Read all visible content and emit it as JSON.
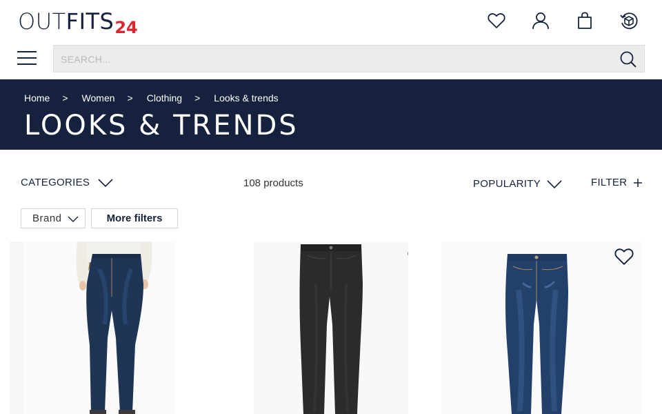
{
  "header": {
    "logo": {
      "part1": "OUT",
      "part2": "FITS",
      "part3": "24"
    },
    "icons": [
      "heart-icon",
      "user-icon",
      "bag-icon",
      "order-box-icon"
    ],
    "search": {
      "placeholder": "SEARCH...",
      "value": ""
    }
  },
  "breadcrumb": [
    {
      "label": "Home"
    },
    {
      "label": "Women"
    },
    {
      "label": "Clothing"
    },
    {
      "label": "Looks & trends"
    }
  ],
  "breadcrumb_separator": ">",
  "page": {
    "title": "LOOKS & TRENDS"
  },
  "toolbar": {
    "categories_label": "CATEGORIES",
    "product_count": "108 products",
    "sort_label": "POPULARITY",
    "filter_label": "FILTER"
  },
  "filters": {
    "brand_label": "Brand",
    "more_filters_label": "More filters"
  },
  "products": [
    {
      "kind": "dark blue skinny jeans on model"
    },
    {
      "kind": "black straight jeans"
    },
    {
      "kind": "blue slim jeans"
    }
  ],
  "colors": {
    "navy": "#16223d",
    "logo_red": "#d8282f",
    "search_bg": "#ececec"
  }
}
